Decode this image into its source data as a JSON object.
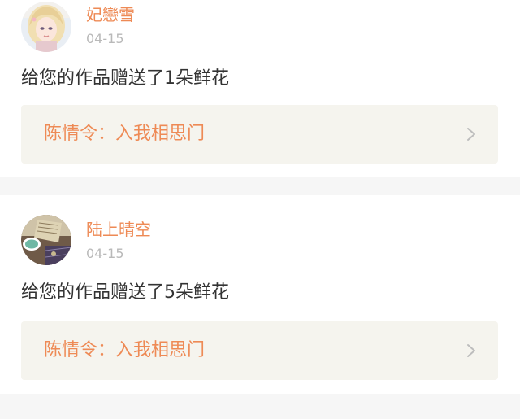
{
  "feed": {
    "items": [
      {
        "username": "妃戀雪",
        "date": "04-15",
        "message": "给您的作品赠送了1朵鲜花",
        "work_title": "陈情令：入我相思门",
        "avatar_icon": "avatar-girl-blonde"
      },
      {
        "username": "陆上晴空",
        "date": "04-15",
        "message": "给您的作品赠送了5朵鲜花",
        "work_title": "陈情令：入我相思门",
        "avatar_icon": "avatar-still-life"
      }
    ]
  },
  "colors": {
    "accent": "#ee8a55",
    "muted": "#b9b9b9",
    "text": "#333333",
    "link_bg": "#f5f4ee",
    "page_bg": "#f6f6f6"
  }
}
